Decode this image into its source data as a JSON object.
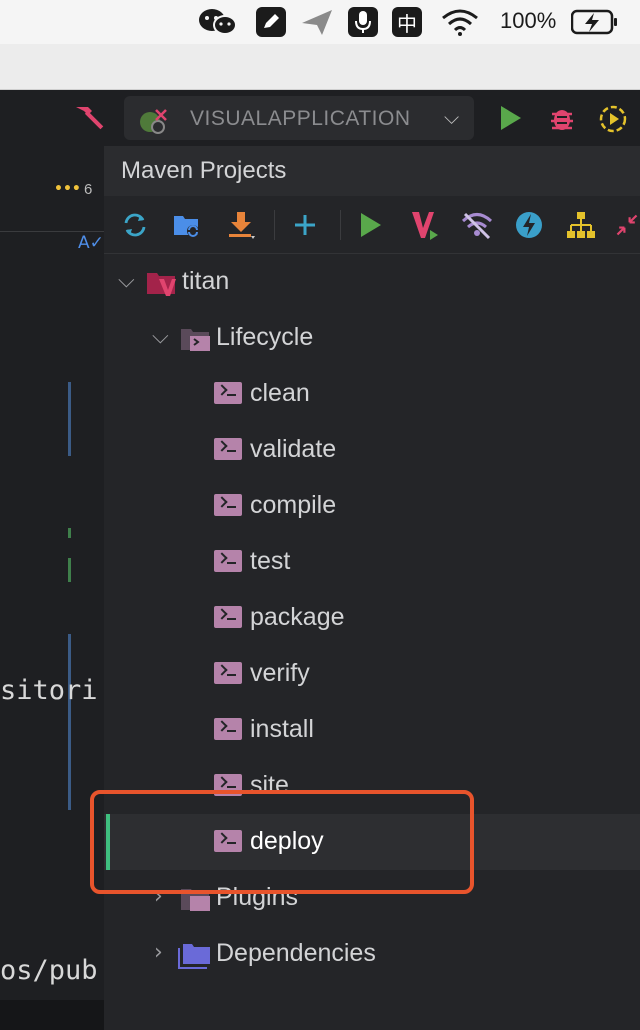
{
  "menubar": {
    "ime_label": "中",
    "battery_percent": "100%"
  },
  "editor": {
    "more_count": "6",
    "code_lines": [
      "sitori",
      "os/pub"
    ]
  },
  "run_toolbar": {
    "configuration_label": "VISUALAPPLICATION"
  },
  "maven": {
    "title": "Maven Projects",
    "project": "titan",
    "lifecycle_label": "Lifecycle",
    "lifecycle_goals": [
      "clean",
      "validate",
      "compile",
      "test",
      "package",
      "verify",
      "install",
      "site",
      "deploy"
    ],
    "plugins_label": "Plugins",
    "dependencies_label": "Dependencies",
    "selected_goal": "deploy"
  },
  "colors": {
    "accent_green": "#3fbf7f",
    "run_green": "#59a84b",
    "debug_red": "#e0446e",
    "highlight_orange": "#e8542c",
    "lifecycle_icon": "#b583aa"
  }
}
